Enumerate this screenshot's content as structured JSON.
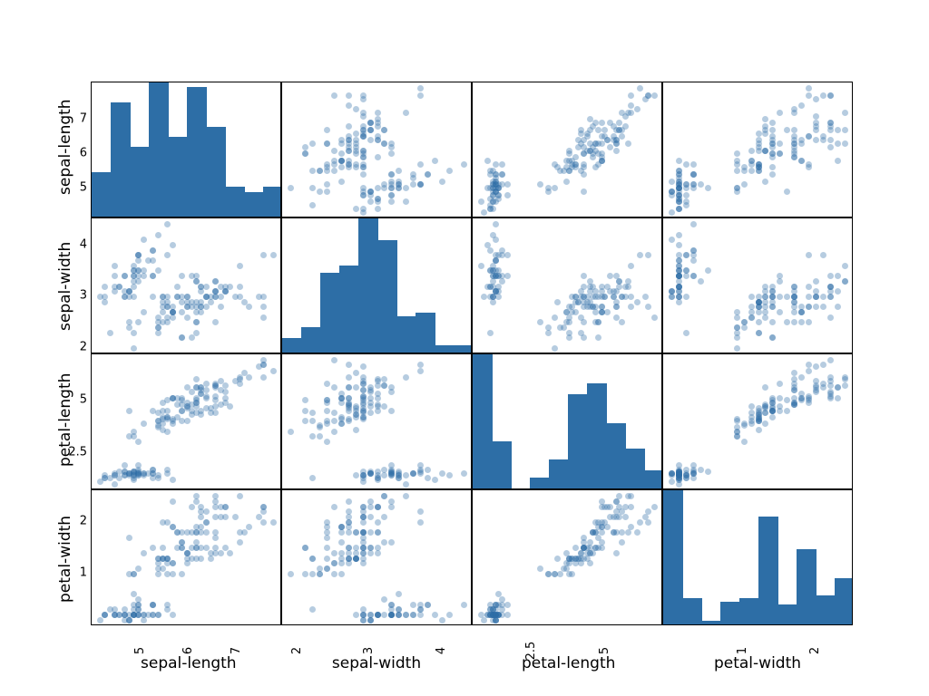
{
  "chart_data": [
    {
      "type": "scatter-matrix",
      "variables": [
        "sepal-length",
        "sepal-width",
        "petal-length",
        "petal-width"
      ],
      "ranges": {
        "sepal-length": [
          4.3,
          7.9
        ],
        "sepal-width": [
          2.0,
          4.4
        ],
        "petal-length": [
          1.0,
          6.9
        ],
        "petal-width": [
          0.1,
          2.5
        ]
      },
      "ticks": {
        "sepal-length": [
          5,
          6,
          7
        ],
        "sepal-width": [
          2,
          3,
          4
        ],
        "petal-length": [
          2.5,
          5.0
        ],
        "petal-width": [
          1,
          2
        ]
      },
      "observations": [
        [
          5.1,
          3.5,
          1.4,
          0.2
        ],
        [
          4.9,
          3.0,
          1.4,
          0.2
        ],
        [
          4.7,
          3.2,
          1.3,
          0.2
        ],
        [
          4.6,
          3.1,
          1.5,
          0.2
        ],
        [
          5.0,
          3.6,
          1.4,
          0.2
        ],
        [
          5.4,
          3.9,
          1.7,
          0.4
        ],
        [
          4.6,
          3.4,
          1.4,
          0.3
        ],
        [
          5.0,
          3.4,
          1.5,
          0.2
        ],
        [
          4.4,
          2.9,
          1.4,
          0.2
        ],
        [
          4.9,
          3.1,
          1.5,
          0.1
        ],
        [
          5.4,
          3.7,
          1.5,
          0.2
        ],
        [
          4.8,
          3.4,
          1.6,
          0.2
        ],
        [
          4.8,
          3.0,
          1.4,
          0.1
        ],
        [
          4.3,
          3.0,
          1.1,
          0.1
        ],
        [
          5.8,
          4.0,
          1.2,
          0.2
        ],
        [
          5.7,
          4.4,
          1.5,
          0.4
        ],
        [
          5.4,
          3.9,
          1.3,
          0.4
        ],
        [
          5.1,
          3.5,
          1.4,
          0.3
        ],
        [
          5.7,
          3.8,
          1.7,
          0.3
        ],
        [
          5.1,
          3.8,
          1.5,
          0.3
        ],
        [
          5.4,
          3.4,
          1.7,
          0.2
        ],
        [
          5.1,
          3.7,
          1.5,
          0.4
        ],
        [
          4.6,
          3.6,
          1.0,
          0.2
        ],
        [
          5.1,
          3.3,
          1.7,
          0.5
        ],
        [
          4.8,
          3.4,
          1.9,
          0.2
        ],
        [
          5.0,
          3.0,
          1.6,
          0.2
        ],
        [
          5.0,
          3.4,
          1.6,
          0.4
        ],
        [
          5.2,
          3.5,
          1.5,
          0.2
        ],
        [
          5.2,
          3.4,
          1.4,
          0.2
        ],
        [
          4.7,
          3.2,
          1.6,
          0.2
        ],
        [
          4.8,
          3.1,
          1.6,
          0.2
        ],
        [
          5.4,
          3.4,
          1.5,
          0.4
        ],
        [
          5.2,
          4.1,
          1.5,
          0.1
        ],
        [
          5.5,
          4.2,
          1.4,
          0.2
        ],
        [
          4.9,
          3.1,
          1.5,
          0.1
        ],
        [
          5.0,
          3.2,
          1.2,
          0.2
        ],
        [
          5.5,
          3.5,
          1.3,
          0.2
        ],
        [
          4.9,
          3.1,
          1.5,
          0.1
        ],
        [
          4.4,
          3.0,
          1.3,
          0.2
        ],
        [
          5.1,
          3.4,
          1.5,
          0.2
        ],
        [
          5.0,
          3.5,
          1.3,
          0.3
        ],
        [
          4.5,
          2.3,
          1.3,
          0.3
        ],
        [
          4.4,
          3.2,
          1.3,
          0.2
        ],
        [
          5.0,
          3.5,
          1.6,
          0.6
        ],
        [
          5.1,
          3.8,
          1.9,
          0.4
        ],
        [
          4.8,
          3.0,
          1.4,
          0.3
        ],
        [
          5.1,
          3.8,
          1.6,
          0.2
        ],
        [
          4.6,
          3.2,
          1.4,
          0.2
        ],
        [
          5.3,
          3.7,
          1.5,
          0.2
        ],
        [
          5.0,
          3.3,
          1.4,
          0.2
        ],
        [
          7.0,
          3.2,
          4.7,
          1.4
        ],
        [
          6.4,
          3.2,
          4.5,
          1.5
        ],
        [
          6.9,
          3.1,
          4.9,
          1.5
        ],
        [
          5.5,
          2.3,
          4.0,
          1.3
        ],
        [
          6.5,
          2.8,
          4.6,
          1.5
        ],
        [
          5.7,
          2.8,
          4.5,
          1.3
        ],
        [
          6.3,
          3.3,
          4.7,
          1.6
        ],
        [
          4.9,
          2.4,
          3.3,
          1.0
        ],
        [
          6.6,
          2.9,
          4.6,
          1.3
        ],
        [
          5.2,
          2.7,
          3.9,
          1.4
        ],
        [
          5.0,
          2.0,
          3.5,
          1.0
        ],
        [
          5.9,
          3.0,
          4.2,
          1.5
        ],
        [
          6.0,
          2.2,
          4.0,
          1.0
        ],
        [
          6.1,
          2.9,
          4.7,
          1.4
        ],
        [
          5.6,
          2.9,
          3.6,
          1.3
        ],
        [
          6.7,
          3.1,
          4.4,
          1.4
        ],
        [
          5.6,
          3.0,
          4.5,
          1.5
        ],
        [
          5.8,
          2.7,
          4.1,
          1.0
        ],
        [
          6.2,
          2.2,
          4.5,
          1.5
        ],
        [
          5.6,
          2.5,
          3.9,
          1.1
        ],
        [
          5.9,
          3.2,
          4.8,
          1.8
        ],
        [
          6.1,
          2.8,
          4.0,
          1.3
        ],
        [
          6.3,
          2.5,
          4.9,
          1.5
        ],
        [
          6.1,
          2.8,
          4.7,
          1.2
        ],
        [
          6.4,
          2.9,
          4.3,
          1.3
        ],
        [
          6.6,
          3.0,
          4.4,
          1.4
        ],
        [
          6.8,
          2.8,
          4.8,
          1.4
        ],
        [
          6.7,
          3.0,
          5.0,
          1.7
        ],
        [
          6.0,
          2.9,
          4.5,
          1.5
        ],
        [
          5.7,
          2.6,
          3.5,
          1.0
        ],
        [
          5.5,
          2.4,
          3.8,
          1.1
        ],
        [
          5.5,
          2.4,
          3.7,
          1.0
        ],
        [
          5.8,
          2.7,
          3.9,
          1.2
        ],
        [
          6.0,
          2.7,
          5.1,
          1.6
        ],
        [
          5.4,
          3.0,
          4.5,
          1.5
        ],
        [
          6.0,
          3.4,
          4.5,
          1.6
        ],
        [
          6.7,
          3.1,
          4.7,
          1.5
        ],
        [
          6.3,
          2.3,
          4.4,
          1.3
        ],
        [
          5.6,
          3.0,
          4.1,
          1.3
        ],
        [
          5.5,
          2.5,
          4.0,
          1.3
        ],
        [
          5.5,
          2.6,
          4.4,
          1.2
        ],
        [
          6.1,
          3.0,
          4.6,
          1.4
        ],
        [
          5.8,
          2.6,
          4.0,
          1.2
        ],
        [
          5.0,
          2.3,
          3.3,
          1.0
        ],
        [
          5.6,
          2.7,
          4.2,
          1.3
        ],
        [
          5.7,
          3.0,
          4.2,
          1.2
        ],
        [
          5.7,
          2.9,
          4.2,
          1.3
        ],
        [
          6.2,
          2.9,
          4.3,
          1.3
        ],
        [
          5.1,
          2.5,
          3.0,
          1.1
        ],
        [
          5.7,
          2.8,
          4.1,
          1.3
        ],
        [
          6.3,
          3.3,
          6.0,
          2.5
        ],
        [
          5.8,
          2.7,
          5.1,
          1.9
        ],
        [
          7.1,
          3.0,
          5.9,
          2.1
        ],
        [
          6.3,
          2.9,
          5.6,
          1.8
        ],
        [
          6.5,
          3.0,
          5.8,
          2.2
        ],
        [
          7.6,
          3.0,
          6.6,
          2.1
        ],
        [
          4.9,
          2.5,
          4.5,
          1.7
        ],
        [
          7.3,
          2.9,
          6.3,
          1.8
        ],
        [
          6.7,
          2.5,
          5.8,
          1.8
        ],
        [
          7.2,
          3.6,
          6.1,
          2.5
        ],
        [
          6.5,
          3.2,
          5.1,
          2.0
        ],
        [
          6.4,
          2.7,
          5.3,
          1.9
        ],
        [
          6.8,
          3.0,
          5.5,
          2.1
        ],
        [
          5.7,
          2.5,
          5.0,
          2.0
        ],
        [
          5.8,
          2.8,
          5.1,
          2.4
        ],
        [
          6.4,
          3.2,
          5.3,
          2.3
        ],
        [
          6.5,
          3.0,
          5.5,
          1.8
        ],
        [
          7.7,
          3.8,
          6.7,
          2.2
        ],
        [
          7.7,
          2.6,
          6.9,
          2.3
        ],
        [
          6.0,
          2.2,
          5.0,
          1.5
        ],
        [
          6.9,
          3.2,
          5.7,
          2.3
        ],
        [
          5.6,
          2.8,
          4.9,
          2.0
        ],
        [
          7.7,
          2.8,
          6.7,
          2.0
        ],
        [
          6.3,
          2.7,
          4.9,
          1.8
        ],
        [
          6.7,
          3.3,
          5.7,
          2.1
        ],
        [
          7.2,
          3.2,
          6.0,
          1.8
        ],
        [
          6.2,
          2.8,
          4.8,
          1.8
        ],
        [
          6.1,
          3.0,
          4.9,
          1.8
        ],
        [
          6.4,
          2.8,
          5.6,
          2.1
        ],
        [
          7.2,
          3.0,
          5.8,
          1.6
        ],
        [
          7.4,
          2.8,
          6.1,
          1.9
        ],
        [
          7.9,
          3.8,
          6.4,
          2.0
        ],
        [
          6.4,
          2.8,
          5.6,
          2.2
        ],
        [
          6.3,
          2.8,
          5.1,
          1.5
        ],
        [
          6.1,
          2.6,
          5.6,
          1.4
        ],
        [
          7.7,
          3.0,
          6.1,
          2.3
        ],
        [
          6.3,
          3.4,
          5.6,
          2.4
        ],
        [
          6.4,
          3.1,
          5.5,
          1.8
        ],
        [
          6.0,
          3.0,
          4.8,
          1.8
        ],
        [
          6.9,
          3.1,
          5.4,
          2.1
        ],
        [
          6.7,
          3.1,
          5.6,
          2.4
        ],
        [
          6.9,
          3.1,
          5.1,
          2.3
        ],
        [
          5.8,
          2.7,
          5.1,
          1.9
        ],
        [
          6.8,
          3.2,
          5.9,
          2.3
        ],
        [
          6.7,
          3.3,
          5.7,
          2.5
        ],
        [
          6.7,
          3.0,
          5.2,
          2.3
        ],
        [
          6.3,
          2.5,
          5.0,
          1.9
        ],
        [
          6.5,
          3.0,
          5.2,
          2.0
        ],
        [
          6.2,
          3.4,
          5.4,
          2.3
        ],
        [
          5.9,
          3.0,
          5.1,
          1.8
        ]
      ],
      "histograms": {
        "bins": 10,
        "counts": {
          "sepal-length": [
            9,
            23,
            14,
            27,
            16,
            26,
            18,
            6,
            5,
            6
          ],
          "sepal-width": [
            4,
            7,
            22,
            24,
            37,
            31,
            10,
            11,
            2,
            2
          ],
          "petal-length": [
            37,
            13,
            0,
            3,
            8,
            26,
            29,
            18,
            11,
            5
          ],
          "petal-width": [
            41,
            8,
            1,
            7,
            8,
            33,
            6,
            23,
            9,
            14
          ]
        }
      }
    }
  ],
  "labels": {
    "vars": [
      "sepal-length",
      "sepal-width",
      "petal-length",
      "petal-width"
    ]
  }
}
